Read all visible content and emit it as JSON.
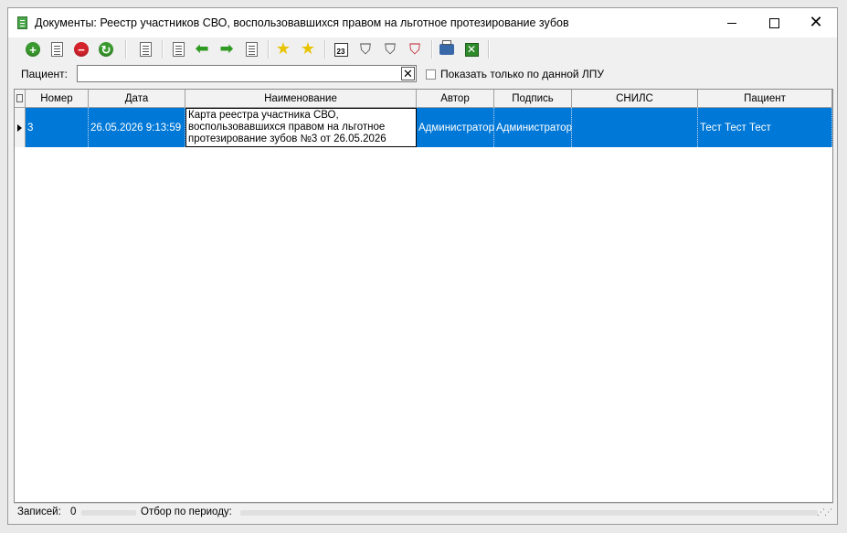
{
  "window": {
    "title": "Документы: Реестр участников СВО, воспользовавшихся правом на льготное протезирование зубов"
  },
  "toolbar": {
    "buttons": [
      {
        "name": "add-icon",
        "glyph": "+"
      },
      {
        "name": "edit-icon"
      },
      {
        "name": "delete-icon",
        "glyph": "−"
      },
      {
        "name": "refresh-icon",
        "glyph": "↻"
      },
      {
        "name": "document-delete-icon"
      },
      {
        "name": "copy-icon"
      },
      {
        "name": "arrow-left-icon",
        "glyph": "⬅"
      },
      {
        "name": "arrow-right-icon",
        "glyph": "➡"
      },
      {
        "name": "list-icon"
      },
      {
        "name": "star-add-icon",
        "glyph": "★"
      },
      {
        "name": "star-icon",
        "glyph": "★"
      },
      {
        "name": "calendar-icon",
        "glyph": "23"
      },
      {
        "name": "filter-icon",
        "glyph": "⛉"
      },
      {
        "name": "filter-edit-icon",
        "glyph": "⛉"
      },
      {
        "name": "filter-clear-icon",
        "glyph": "⛉"
      },
      {
        "name": "print-icon"
      },
      {
        "name": "excel-export-icon",
        "glyph": "✕"
      }
    ]
  },
  "filter": {
    "patient_label": "Пациент:",
    "patient_value": "",
    "clear_glyph": "✕",
    "show_only_label": "Показать только по данной ЛПУ",
    "show_only_checked": false
  },
  "grid": {
    "columns": [
      "Номер",
      "Дата",
      "Наименование",
      "Автор",
      "Подпись",
      "СНИЛС",
      "Пациент"
    ],
    "rows": [
      {
        "number": "3",
        "date": "26.05.2026 9:13:59",
        "name": "Карта реестра участника СВО, воспользовавшихся правом на льготное протезирование зубов №3 от 26.05.2026",
        "author": "Администратор",
        "signature": "Администратор",
        "snils": "",
        "patient": "Тест Тест Тест"
      }
    ]
  },
  "status": {
    "records_label": "Записей:",
    "records_count": "0",
    "period_label": "Отбор по периоду:"
  },
  "colors": {
    "selection": "#0078d7",
    "accent_green": "#3a9a2f",
    "accent_red": "#d4232b"
  }
}
